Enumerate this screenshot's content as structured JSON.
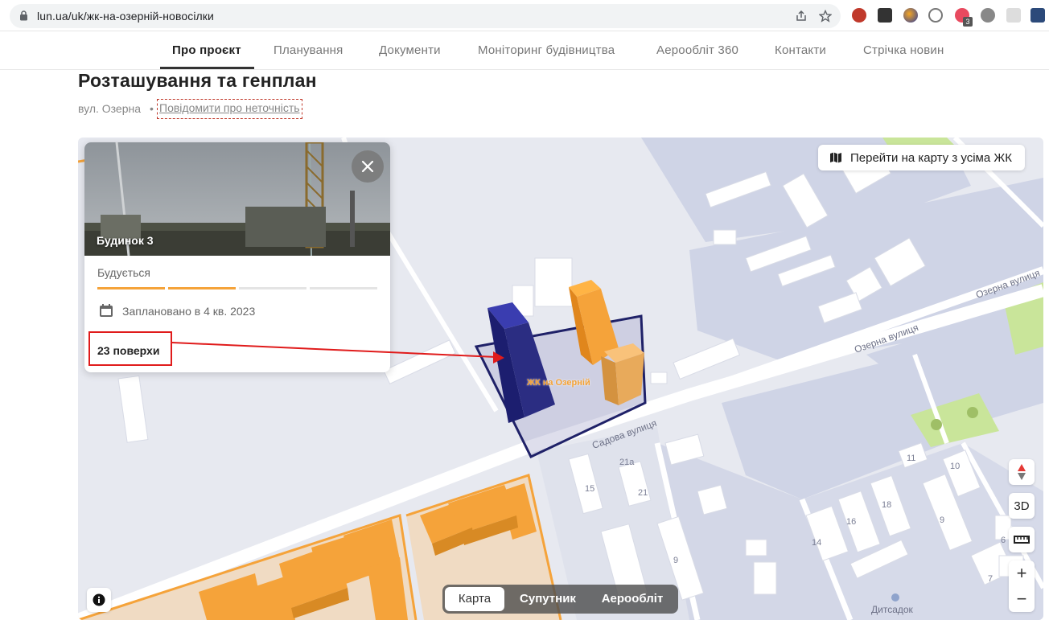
{
  "browser": {
    "url": "lun.ua/uk/жк-на-озерній-новосілки",
    "extension_badge": "3"
  },
  "nav": {
    "tabs": [
      {
        "label": "Про проєкт",
        "active": true
      },
      {
        "label": "Планування"
      },
      {
        "label": "Документи"
      },
      {
        "label": "Моніторинг будівництва"
      },
      {
        "label": "Аерообліт 360"
      },
      {
        "label": "Контакти"
      },
      {
        "label": "Стрічка новин"
      }
    ]
  },
  "heading": {
    "title": "Розташування та генплан",
    "address": "вул. Озерна",
    "separator": "•",
    "report_link": "Повідомити про неточність"
  },
  "map": {
    "all_complexes_button": "Перейти на карту з усіма ЖК",
    "complex_label": "ЖК на Озерній",
    "streets": {
      "ozerna_1": "Озерна вулиця",
      "ozerna_2": "Озерна вулиця",
      "sadova": "Садова вулиця"
    },
    "house_numbers": [
      "21а",
      "21",
      "15",
      "9",
      "14",
      "16",
      "18",
      "11",
      "10",
      "9",
      "6",
      "7"
    ],
    "kindergarten": "Дитсадок",
    "control_3d": "3D",
    "zoom_in": "+",
    "zoom_out": "−",
    "map_types": [
      {
        "label": "Карта",
        "active": true
      },
      {
        "label": "Супутник"
      },
      {
        "label": "Аерообліт"
      }
    ],
    "colors": {
      "highlight": "#f5a33a",
      "building_dark": "#2b2d82",
      "annotation": "#e01b1b"
    }
  },
  "card": {
    "building_name": "Будинок 3",
    "status": "Будується",
    "progress_segments_done": 2,
    "progress_segments_total": 4,
    "planned": "Заплановано в 4 кв. 2023",
    "floors": "23 поверхи"
  }
}
